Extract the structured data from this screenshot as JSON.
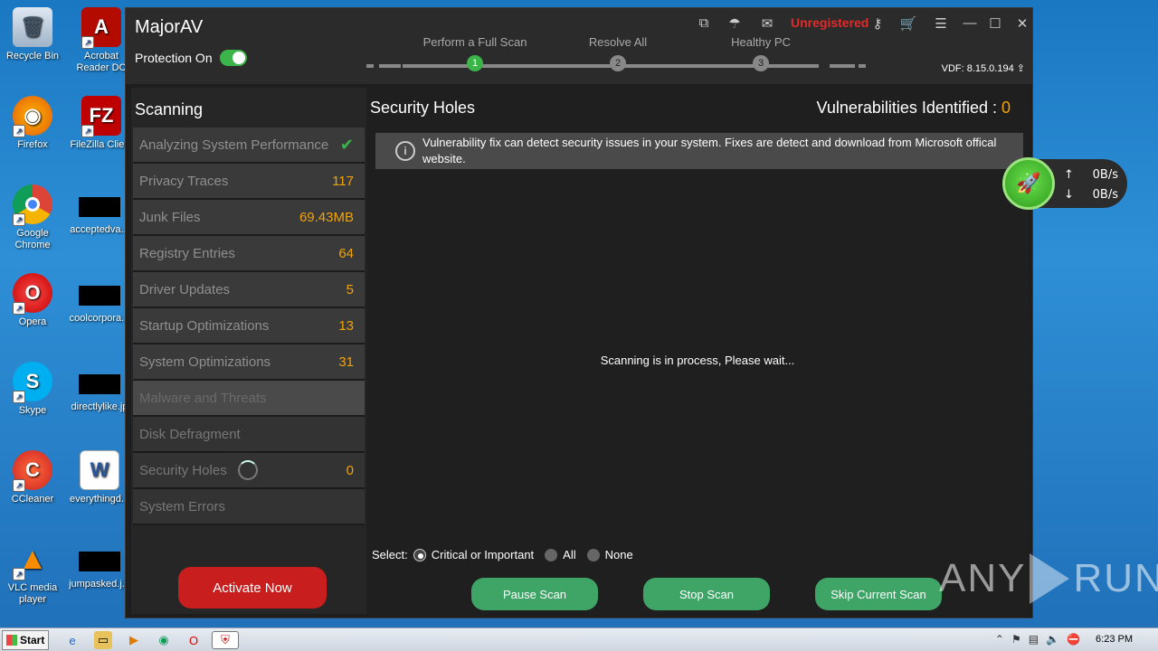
{
  "desktop": {
    "icons": [
      {
        "label": "Recycle Bin",
        "icon": "recycle-bin-icon"
      },
      {
        "label": "Acrobat Reader DC",
        "icon": "acrobat-icon"
      },
      {
        "label": "Firefox",
        "icon": "firefox-icon"
      },
      {
        "label": "FileZilla Client",
        "icon": "filezilla-icon"
      },
      {
        "label": "Google Chrome",
        "icon": "chrome-icon"
      },
      {
        "label": "acceptedva...",
        "icon": "file-icon"
      },
      {
        "label": "Opera",
        "icon": "opera-icon"
      },
      {
        "label": "coolcorpora...",
        "icon": "file-icon"
      },
      {
        "label": "Skype",
        "icon": "skype-icon"
      },
      {
        "label": "directlylike.jp",
        "icon": "file-icon"
      },
      {
        "label": "CCleaner",
        "icon": "ccleaner-icon"
      },
      {
        "label": "everythingd...",
        "icon": "word-doc-icon"
      },
      {
        "label": "VLC media player",
        "icon": "vlc-icon"
      },
      {
        "label": "jumpasked.j...",
        "icon": "file-icon"
      }
    ]
  },
  "app": {
    "title": "MajorAV",
    "protection_label": "Protection On",
    "steps": [
      {
        "label": "Perform a Full Scan",
        "num": "1"
      },
      {
        "label": "Resolve All",
        "num": "2"
      },
      {
        "label": "Healthy PC",
        "num": "3"
      }
    ],
    "unregistered": "Unregistered",
    "vdf": "VDF: 8.15.0.194",
    "left_title": "Scanning",
    "scan_items": [
      {
        "label": "Analyzing System Performance",
        "value": ""
      },
      {
        "label": "Privacy Traces",
        "value": "117"
      },
      {
        "label": "Junk Files",
        "value": "69.43MB"
      },
      {
        "label": "Registry Entries",
        "value": "64"
      },
      {
        "label": "Driver Updates",
        "value": "5"
      },
      {
        "label": "Startup Optimizations",
        "value": "13"
      },
      {
        "label": "System Optimizations",
        "value": "31"
      },
      {
        "label": "Malware and Threats",
        "value": ""
      },
      {
        "label": "Disk Defragment",
        "value": ""
      },
      {
        "label": "Security Holes",
        "value": "0"
      },
      {
        "label": "System Errors",
        "value": ""
      }
    ],
    "activate_label": "Activate Now",
    "right_title": "Security Holes",
    "vuln_label": "Vulnerabilities Identified : ",
    "vuln_count": "0",
    "info_text": "Vulnerability fix can detect security issues in your system. Fixes are detect and download from Microsoft offical website.",
    "status_text": "Scanning is in process, Please wait...",
    "select_label": "Select:",
    "select_options": [
      "Critical or Important",
      "All",
      "None"
    ],
    "buttons": {
      "pause": "Pause Scan",
      "stop": "Stop Scan",
      "skip": "Skip Current Scan"
    }
  },
  "net": {
    "up": "0B/s",
    "down": "0B/s"
  },
  "watermark": {
    "left": "ANY",
    "right": "RUN"
  },
  "taskbar": {
    "start": "Start",
    "clock": "6:23 PM"
  }
}
